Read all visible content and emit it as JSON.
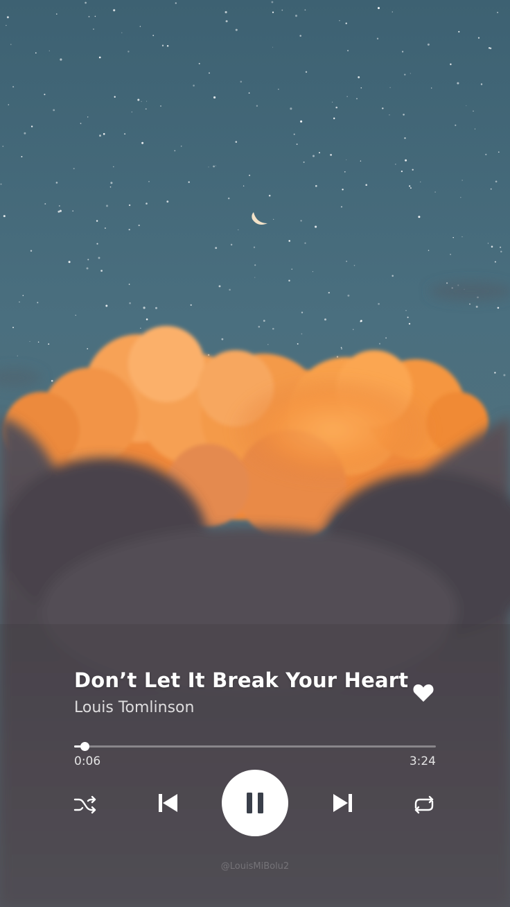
{
  "track": {
    "title": "Don’t Let It Break Your Heart",
    "artist": "Louis Tomlinson",
    "liked": true
  },
  "playback": {
    "elapsed": "0:06",
    "total": "3:24",
    "progress_fraction": 0.029,
    "state": "playing"
  },
  "controls": {
    "shuffle_icon": "shuffle-icon",
    "previous_icon": "skip-previous-icon",
    "play_pause_icon": "pause-icon",
    "next_icon": "skip-next-icon",
    "repeat_icon": "repeat-icon",
    "like_icon": "heart-icon"
  },
  "watermark": "@LouisMiBolu2",
  "colors": {
    "sky_top": "#3f6373",
    "sky_mid": "#4d7382",
    "cloud_glow": "#f59b45",
    "cloud_dark": "#4e4a52",
    "accent": "#ffffff"
  }
}
